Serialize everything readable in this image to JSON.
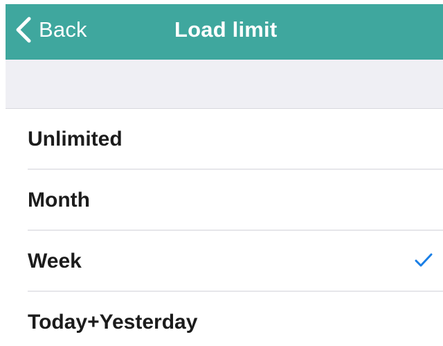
{
  "nav": {
    "back_label": "Back",
    "title": "Load limit",
    "back_icon": "chevron-left-icon"
  },
  "colors": {
    "nav_background": "#3fa79e",
    "checkmark": "#1a7fe6",
    "section_gap": "#efeff4"
  },
  "options": [
    {
      "label": "Unlimited",
      "selected": false
    },
    {
      "label": "Month",
      "selected": false
    },
    {
      "label": "Week",
      "selected": true
    },
    {
      "label": "Today+Yesterday",
      "selected": false
    }
  ],
  "selected_icon": "checkmark-icon"
}
